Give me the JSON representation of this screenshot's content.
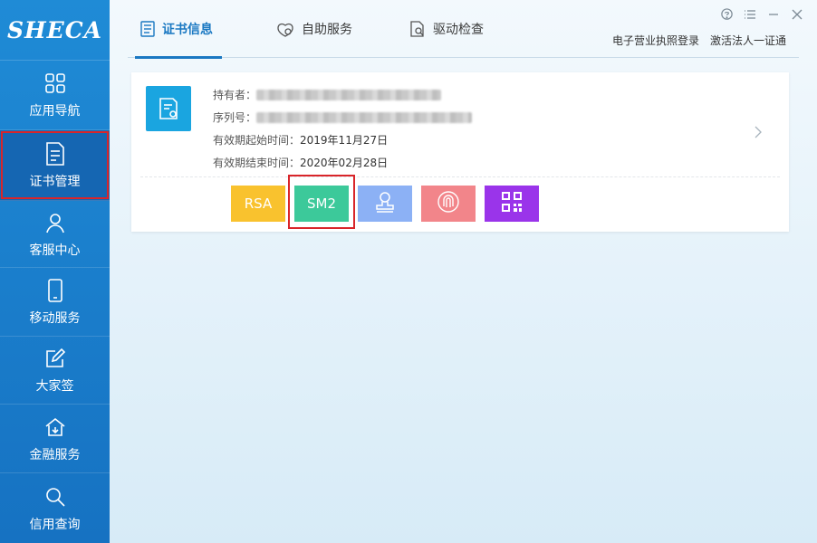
{
  "sidebar": {
    "logo": "SHECA",
    "items": [
      {
        "label": "应用导航",
        "icon": "apps-grid-icon"
      },
      {
        "label": "证书管理",
        "icon": "certificate-doc-icon"
      },
      {
        "label": "客服中心",
        "icon": "user-icon"
      },
      {
        "label": "移动服务",
        "icon": "mobile-icon"
      },
      {
        "label": "大家签",
        "icon": "sign-pen-icon"
      },
      {
        "label": "金融服务",
        "icon": "finance-house-icon"
      },
      {
        "label": "信用查询",
        "icon": "search-icon"
      }
    ]
  },
  "tabs": [
    {
      "label": "证书信息",
      "icon": "list-doc-icon"
    },
    {
      "label": "自助服务",
      "icon": "handshake-icon"
    },
    {
      "label": "驱动检查",
      "icon": "doc-search-icon"
    }
  ],
  "top_links": {
    "license_login": "电子营业执照登录",
    "activate": "激活法人一证通"
  },
  "certificate": {
    "holder_label": "持有者：",
    "serial_label": "序列号：",
    "valid_from_label": "有效期起始时间：",
    "valid_from": "2019年11月27日",
    "valid_to_label": "有效期结束时间：",
    "valid_to": "2020年02月28日"
  },
  "algorithms": {
    "rsa": "RSA",
    "sm2": "SM2"
  },
  "colors": {
    "sidebar": "#1c7fcd",
    "accent": "#1a78c2",
    "rsa": "#f9c22e",
    "sm2": "#3cc99a",
    "seal": "#8cb1f5",
    "fingerprint": "#f2858a",
    "qr": "#9a34ea",
    "highlight": "#d9252a"
  }
}
